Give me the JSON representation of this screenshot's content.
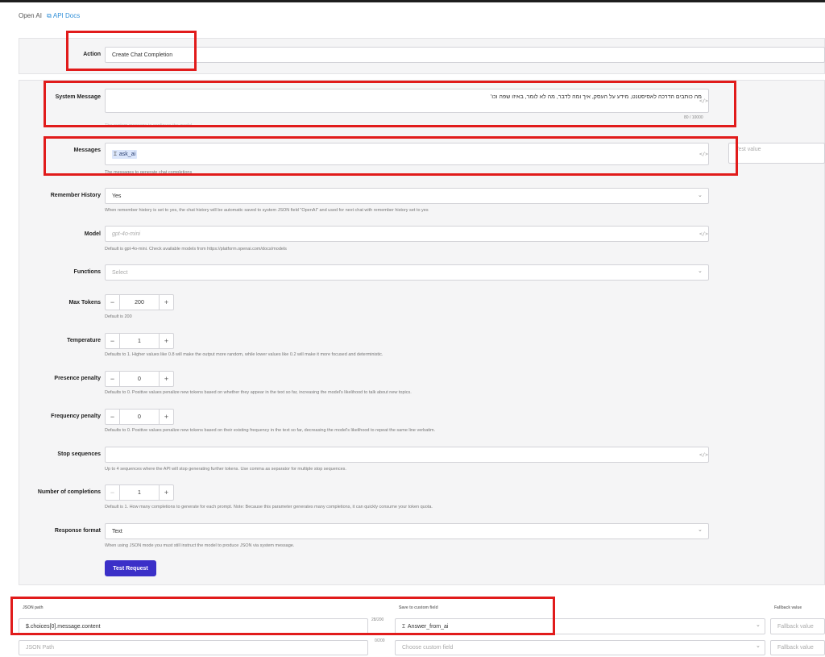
{
  "breadcrumb": {
    "app": "Open AI",
    "docs_link": "API Docs"
  },
  "action": {
    "label": "Action",
    "value": "Create Chat Completion"
  },
  "system_message": {
    "label": "System Message",
    "value": "מה כותבים הדרכה לאסיסטנט, מידע על העסק, איך ומה לדבר, מה לא לומר, באיזו שפה וכו'",
    "counter": "80 / 10000",
    "hint": "The system message to configure the model"
  },
  "messages": {
    "label": "Messages",
    "chip": "ask_ai",
    "hint": "The messages to generate chat completions",
    "side_placeholder": "Test value"
  },
  "remember_history": {
    "label": "Remember History",
    "value": "Yes",
    "hint": "When remember history is set to yes, the chat history will be automatic saved to system JSON field \"OpenAI\" and used for next chat with remember history set to yes"
  },
  "model": {
    "label": "Model",
    "placeholder": "gpt-4o-mini",
    "hint": "Default is gpt-4o-mini. Check available models from https://platform.openai.com/docs/models"
  },
  "functions": {
    "label": "Functions",
    "placeholder": "Select"
  },
  "max_tokens": {
    "label": "Max Tokens",
    "value": "200",
    "hint": "Default is 200"
  },
  "temperature": {
    "label": "Temperature",
    "value": "1",
    "hint": "Defaults to 1. Higher values like 0.8 will make the output more random, while lower values like 0.2 will make it more focused and deterministic."
  },
  "presence_penalty": {
    "label": "Presence penalty",
    "value": "0",
    "hint": "Defaults to 0. Positive values penalize new tokens based on whether they appear in the text so far, increasing the model's likelihood to talk about new topics."
  },
  "frequency_penalty": {
    "label": "Frequency penalty",
    "value": "0",
    "hint": "Defaults to 0. Positive values penalize new tokens based on their existing frequency in the text so far, decreasing the model's likelihood to repeat the same line verbatim."
  },
  "stop_sequences": {
    "label": "Stop sequences",
    "hint": "Up to 4 sequences where the API will stop generating further tokens. Use comma as separator for multiple stop sequences."
  },
  "completions": {
    "label": "Number of completions",
    "value": "1",
    "hint": "Default is 1. How many completions to generate for each prompt. Note: Because this parameter generates many completions, it can quickly consume your token quota."
  },
  "response_format": {
    "label": "Response format",
    "value": "Text",
    "hint": "When using JSON mode you must still instruct the model to produce JSON via system message."
  },
  "test_button": "Test Request",
  "mapping": {
    "headers": {
      "json_path": "JSON path",
      "custom_field": "Save to custom field",
      "fallback": "Fallback value"
    },
    "rows": [
      {
        "path": "$.choices[0].message.content",
        "counter": "28/200",
        "field": "Answer_from_ai",
        "fallback_placeholder": "Fallback value"
      },
      {
        "path_placeholder": "JSON Path",
        "counter": "0/200",
        "field_placeholder": "Choose custom field",
        "fallback_placeholder": "Fallback value"
      }
    ]
  }
}
